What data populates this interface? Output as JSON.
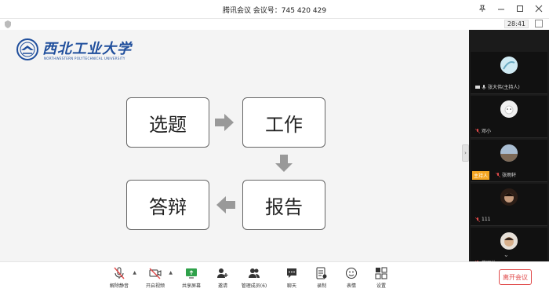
{
  "window": {
    "title": "腾讯会议  会议号：745 420 429",
    "clock": "28:41"
  },
  "slide": {
    "logo_cn": "西北工业大学",
    "logo_en": "NORTHWESTERN POLYTECHNICAL UNIVERSITY",
    "boxes": [
      "选题",
      "工作",
      "报告",
      "答辩"
    ]
  },
  "participants": [
    {
      "name": "张大伟(主持人)",
      "muted": false
    },
    {
      "name": "邓小",
      "muted": true
    },
    {
      "name": "张雨轩",
      "muted": true,
      "host_badge": "主持人"
    },
    {
      "name": "111",
      "muted": true
    },
    {
      "name": "蔡明灿",
      "muted": true
    }
  ],
  "toolbar": {
    "mute": "解除静音",
    "video": "开启视频",
    "share": "共享屏幕",
    "invite": "邀请",
    "members": "管理成员(6)",
    "chat": "聊天",
    "record": "录制",
    "apps": "表情",
    "settings": "设置",
    "leave": "离开会议"
  },
  "colors": {
    "accent_green": "#2fa14a",
    "danger": "#e04a4a",
    "host_badge": "#f5a623",
    "logo_blue": "#1f4e9c"
  }
}
